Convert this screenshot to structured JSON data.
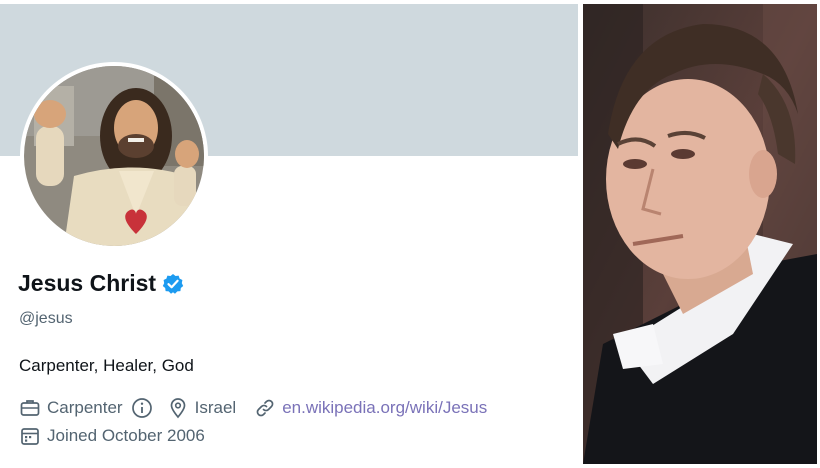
{
  "profile": {
    "display_name": "Jesus Christ",
    "handle": "@jesus",
    "bio": "Carpenter, Healer, God",
    "occupation": "Carpenter",
    "location": "Israel",
    "website": "en.wikipedia.org/wiki/Jesus",
    "joined": "Joined October 2006",
    "icons": {
      "occupation": "briefcase-icon",
      "info": "info-icon",
      "location": "location-pin-icon",
      "website": "link-icon",
      "joined": "calendar-icon",
      "verified": "verified-badge-icon"
    }
  },
  "colors": {
    "banner": "#cfd9de",
    "verified": "#1d9bf0",
    "link": "#7a72b8",
    "secondary_text": "#536471",
    "primary_text": "#0f1419"
  }
}
